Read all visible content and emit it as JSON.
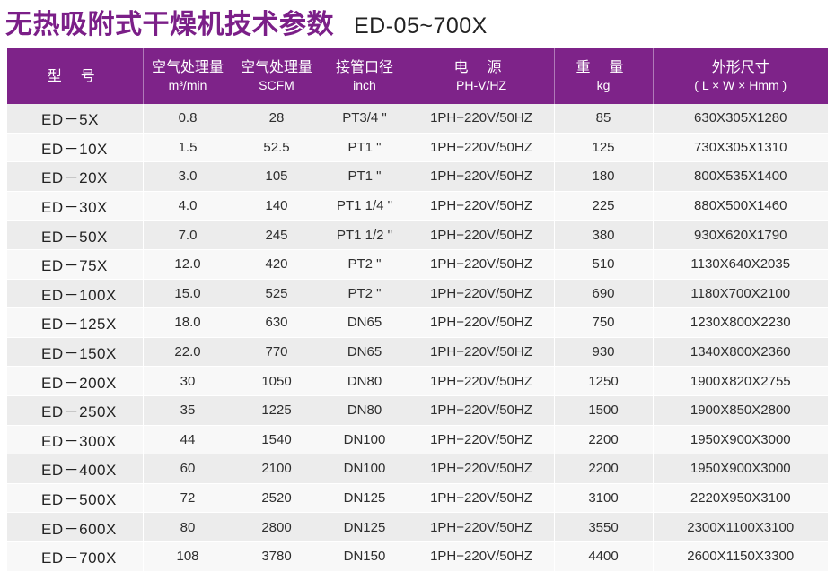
{
  "title": {
    "main": "无热吸附式干燥机技术参数",
    "model_range": "ED-05~700X"
  },
  "table": {
    "headers": [
      {
        "line1": "型 号",
        "line2": ""
      },
      {
        "line1": "空气处理量",
        "line2": "m³/min"
      },
      {
        "line1": "空气处理量",
        "line2": "SCFM"
      },
      {
        "line1": "接管口径",
        "line2": "inch"
      },
      {
        "line1": "电 源",
        "line2": "PH-V/HZ"
      },
      {
        "line1": "重 量",
        "line2": "kg"
      },
      {
        "line1": "外形尺寸",
        "line2": "( L × W × Hmm )"
      }
    ],
    "rows": [
      [
        "ED－5X",
        "0.8",
        "28",
        "PT3/4 \"",
        "1PH−220V/50HZ",
        "85",
        "630X305X1280"
      ],
      [
        "ED－10X",
        "1.5",
        "52.5",
        "PT1 \"",
        "1PH−220V/50HZ",
        "125",
        "730X305X1310"
      ],
      [
        "ED－20X",
        "3.0",
        "105",
        "PT1 \"",
        "1PH−220V/50HZ",
        "180",
        "800X535X1400"
      ],
      [
        "ED－30X",
        "4.0",
        "140",
        "PT1 1/4 \"",
        "1PH−220V/50HZ",
        "225",
        "880X500X1460"
      ],
      [
        "ED－50X",
        "7.0",
        "245",
        "PT1 1/2 \"",
        "1PH−220V/50HZ",
        "380",
        "930X620X1790"
      ],
      [
        "ED－75X",
        "12.0",
        "420",
        "PT2 \"",
        "1PH−220V/50HZ",
        "510",
        "1130X640X2035"
      ],
      [
        "ED－100X",
        "15.0",
        "525",
        "PT2 \"",
        "1PH−220V/50HZ",
        "690",
        "1180X700X2100"
      ],
      [
        "ED－125X",
        "18.0",
        "630",
        "DN65",
        "1PH−220V/50HZ",
        "750",
        "1230X800X2230"
      ],
      [
        "ED－150X",
        "22.0",
        "770",
        "DN65",
        "1PH−220V/50HZ",
        "930",
        "1340X800X2360"
      ],
      [
        "ED－200X",
        "30",
        "1050",
        "DN80",
        "1PH−220V/50HZ",
        "1250",
        "1900X820X2755"
      ],
      [
        "ED－250X",
        "35",
        "1225",
        "DN80",
        "1PH−220V/50HZ",
        "1500",
        "1900X850X2800"
      ],
      [
        "ED－300X",
        "44",
        "1540",
        "DN100",
        "1PH−220V/50HZ",
        "2200",
        "1950X900X3000"
      ],
      [
        "ED－400X",
        "60",
        "2100",
        "DN100",
        "1PH−220V/50HZ",
        "2200",
        "1950X900X3000"
      ],
      [
        "ED－500X",
        "72",
        "2520",
        "DN125",
        "1PH−220V/50HZ",
        "3100",
        "2220X950X3100"
      ],
      [
        "ED－600X",
        "80",
        "2800",
        "DN125",
        "1PH−220V/50HZ",
        "3550",
        "2300X1100X3100"
      ],
      [
        "ED－700X",
        "108",
        "3780",
        "DN150",
        "1PH−220V/50HZ",
        "4400",
        "2600X1150X3300"
      ]
    ]
  },
  "colors": {
    "header_bg": "#7e2389",
    "title": "#7b1f88",
    "row_odd": "#ececec",
    "row_even": "#f8f8f8"
  }
}
